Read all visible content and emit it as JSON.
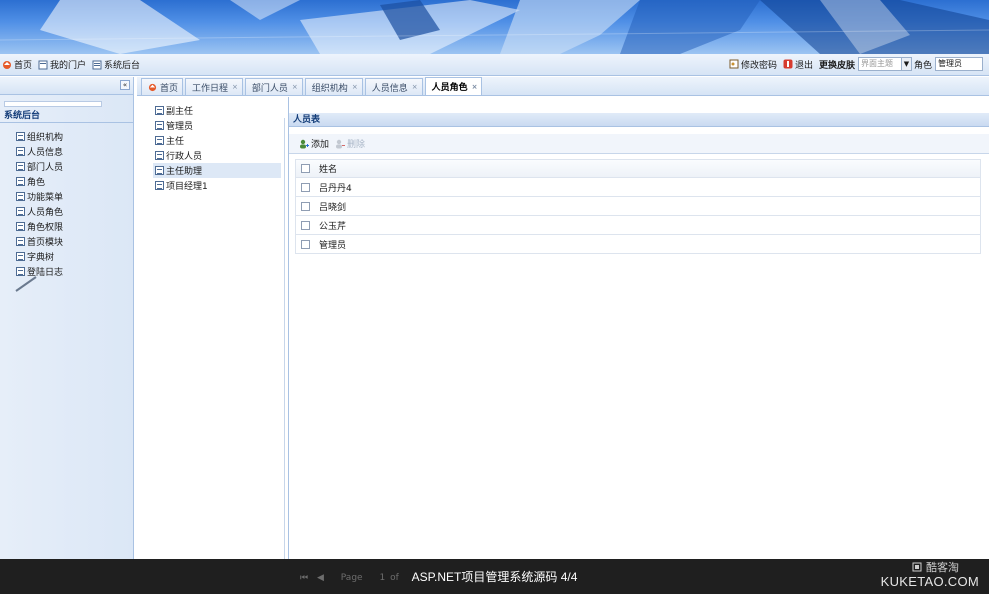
{
  "top_nav": {
    "links": [
      {
        "label": "首页",
        "icon": "home-icon"
      },
      {
        "label": "我的门户",
        "icon": "portal-icon"
      },
      {
        "label": "系统后台",
        "icon": "system-icon"
      }
    ],
    "change_password": "修改密码",
    "logout": "退出",
    "change_theme_label": "更换皮肤",
    "theme_placeholder": "界面主题",
    "role_label": "角色",
    "role_value": "管理员"
  },
  "sidebar": {
    "title": "系统后台",
    "items": [
      "组织机构",
      "人员信息",
      "部门人员",
      "角色",
      "功能菜单",
      "人员角色",
      "角色权限",
      "首页模块",
      "字典树",
      "登陆日志"
    ]
  },
  "tabs": [
    {
      "label": "首页",
      "closable": false
    },
    {
      "label": "工作日程",
      "closable": true
    },
    {
      "label": "部门人员",
      "closable": true
    },
    {
      "label": "组织机构",
      "closable": true
    },
    {
      "label": "人员信息",
      "closable": true
    },
    {
      "label": "人员角色",
      "closable": true,
      "active": true
    }
  ],
  "role_tree": {
    "items": [
      "副主任",
      "管理员",
      "主任",
      "行政人员",
      "主任助理",
      "项目经理1"
    ],
    "selected": "主任助理"
  },
  "grid": {
    "title": "人员表",
    "toolbar": {
      "add": "添加",
      "delete": "删除"
    },
    "column": "姓名",
    "rows": [
      "吕丹丹4",
      "吕晓剑",
      "公玉芹",
      "管理员"
    ]
  },
  "pager": {
    "page_label": "Page",
    "page_num": "1",
    "of_label": "of"
  },
  "overlay": {
    "caption": "ASP.NET项目管理系统源码   4/4",
    "watermark_cn": "酷客淘",
    "watermark_en": "KUKETAO.COM"
  },
  "colors": {
    "banner_blue": "#2c6fd1",
    "panel_border": "#a9c2e3",
    "header_text": "#153e7a",
    "overlay_bg": "#1f1f1f"
  }
}
